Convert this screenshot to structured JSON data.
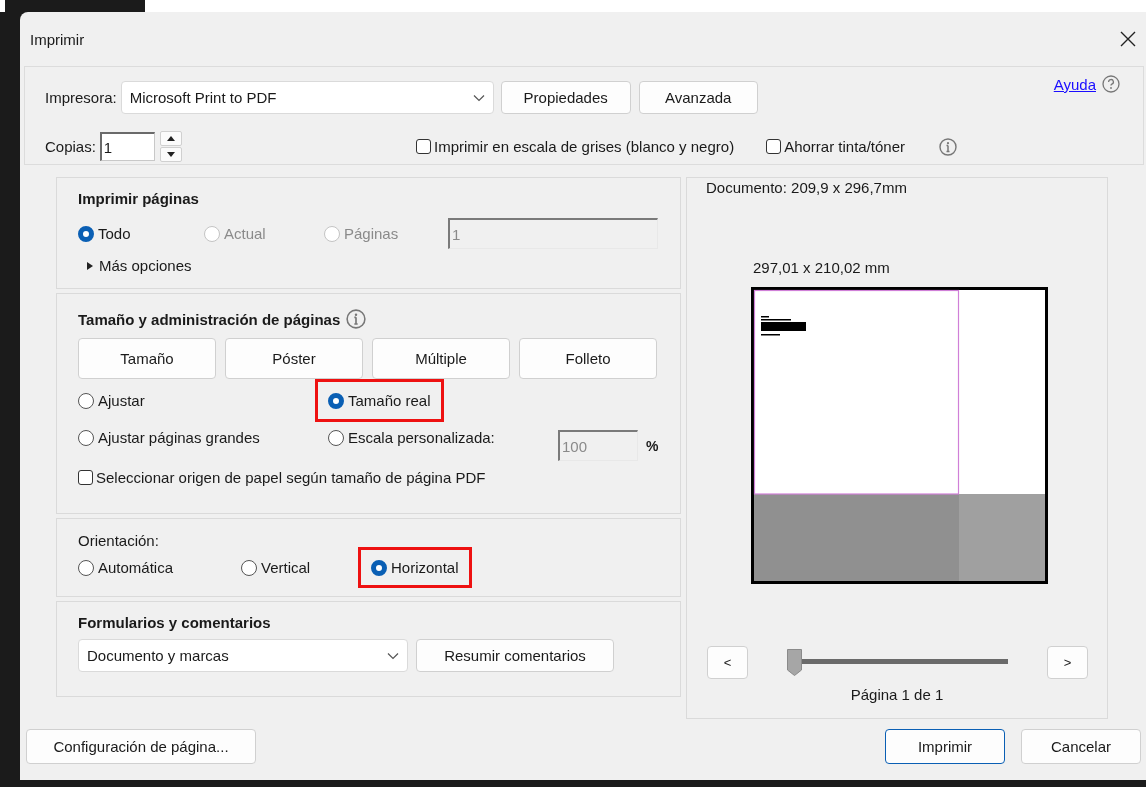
{
  "window": {
    "title": "Imprimir"
  },
  "printer": {
    "label": "Impresora:",
    "value": "Microsoft Print to PDF",
    "buttons": [
      "Propiedades",
      "Avanzada"
    ]
  },
  "help": {
    "link": "Ayuda"
  },
  "copies": {
    "label": "Copias:",
    "value": "1"
  },
  "options": [
    {
      "label": "Imprimir en escala de grises (blanco y negro)",
      "checked": false
    },
    {
      "label": "Ahorrar tinta/tóner",
      "checked": false
    }
  ],
  "print_pages": {
    "title": "Imprimir páginas",
    "choices": [
      {
        "label": "Todo",
        "selected": true,
        "disabled": false
      },
      {
        "label": "Actual",
        "selected": false,
        "disabled": true
      },
      {
        "label": "Páginas",
        "selected": false,
        "disabled": true
      }
    ],
    "pages_value": "1",
    "more": {
      "label": "Más opciones",
      "expanded": false
    }
  },
  "page_handling": {
    "title": "Tamaño y administración de páginas",
    "modes": [
      "Tamaño",
      "Póster",
      "Múltiple",
      "Folleto"
    ],
    "choices": [
      {
        "label": "Ajustar",
        "selected": false,
        "highlighted": false
      },
      {
        "label": "Tamaño real",
        "selected": true,
        "highlighted": true
      },
      {
        "label": "Ajustar páginas grandes",
        "selected": false,
        "highlighted": false
      },
      {
        "label": "Escala personalizada:",
        "selected": false,
        "highlighted": false
      }
    ],
    "scale": {
      "value": "100",
      "unit": "%"
    },
    "paper_source": {
      "label": "Seleccionar origen de papel según tamaño de página PDF",
      "checked": false
    }
  },
  "orientation": {
    "label": "Orientación:",
    "choices": [
      {
        "label": "Automática",
        "selected": false,
        "highlighted": false
      },
      {
        "label": "Vertical",
        "selected": false,
        "highlighted": false
      },
      {
        "label": "Horizontal",
        "selected": true,
        "highlighted": true
      }
    ]
  },
  "forms": {
    "title": "Formularios y comentarios",
    "value": "Documento y marcas",
    "button": "Resumir comentarios"
  },
  "preview": {
    "document_size": "Documento: 209,9 x 296,7mm",
    "paper_size": "297,01 x 210,02 mm",
    "prev": "<",
    "next": ">",
    "slider": {
      "level": 0
    },
    "page_label": "Página 1 de 1"
  },
  "footer": {
    "setup": "Configuración de página...",
    "print": "Imprimir",
    "cancel": "Cancelar"
  }
}
